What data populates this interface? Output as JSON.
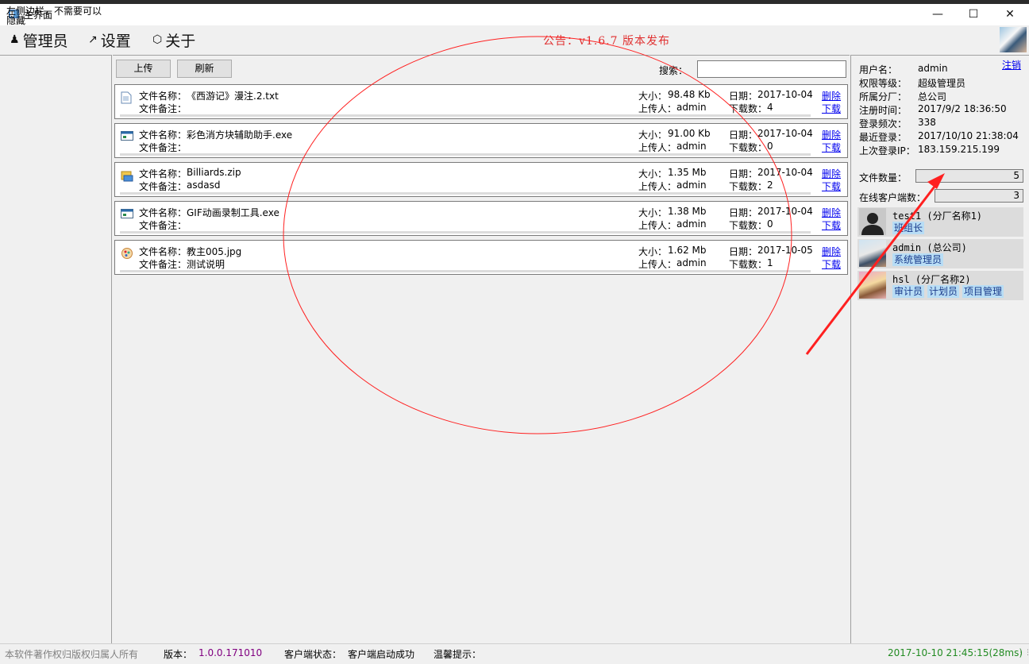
{
  "window": {
    "title": "主界面"
  },
  "menu": [
    {
      "label": "管理员",
      "icon": "users-icon"
    },
    {
      "label": "设置",
      "icon": "arrow-icon"
    },
    {
      "label": "关于",
      "icon": "cube-icon"
    }
  ],
  "notice": "公告：v1.6.7 版本发布",
  "sidebar": {
    "text": "左侧边栏，不需要可以隐藏"
  },
  "toolbar": {
    "upload_label": "上传",
    "refresh_label": "刷新",
    "search_label": "搜索：",
    "search_value": ""
  },
  "files": [
    {
      "name_label": "文件名称：",
      "name": "《西游记》漫注.2.txt",
      "note_label": "文件备注：",
      "note": "",
      "size_label": "大小：",
      "size": "98.48 Kb",
      "uploader_label": "上传人：",
      "uploader": "admin",
      "date_label": "日期：",
      "date": "2017-10-04",
      "downloads_label": "下载数：",
      "downloads": "4",
      "delete": "删除",
      "download": "下载",
      "icon": "text-file-icon"
    },
    {
      "name_label": "文件名称：",
      "name": "彩色消方块辅助助手.exe",
      "note_label": "文件备注：",
      "note": "",
      "size_label": "大小：",
      "size": "91.00 Kb",
      "uploader_label": "上传人：",
      "uploader": "admin",
      "date_label": "日期：",
      "date": "2017-10-04",
      "downloads_label": "下载数：",
      "downloads": "0",
      "delete": "删除",
      "download": "下载",
      "icon": "exe-file-icon"
    },
    {
      "name_label": "文件名称：",
      "name": "Billiards.zip",
      "note_label": "文件备注：",
      "note": "asdasd",
      "size_label": "大小：",
      "size": "1.35 Mb",
      "uploader_label": "上传人：",
      "uploader": "admin",
      "date_label": "日期：",
      "date": "2017-10-04",
      "downloads_label": "下载数：",
      "downloads": "2",
      "delete": "删除",
      "download": "下载",
      "icon": "zip-file-icon"
    },
    {
      "name_label": "文件名称：",
      "name": "GIF动画录制工具.exe",
      "note_label": "文件备注：",
      "note": "",
      "size_label": "大小：",
      "size": "1.38 Mb",
      "uploader_label": "上传人：",
      "uploader": "admin",
      "date_label": "日期：",
      "date": "2017-10-04",
      "downloads_label": "下载数：",
      "downloads": "0",
      "delete": "删除",
      "download": "下载",
      "icon": "exe-file-icon"
    },
    {
      "name_label": "文件名称：",
      "name": "教主005.jpg",
      "note_label": "文件备注：",
      "note": "测试说明",
      "size_label": "大小：",
      "size": "1.62 Mb",
      "uploader_label": "上传人：",
      "uploader": "admin",
      "date_label": "日期：",
      "date": "2017-10-05",
      "downloads_label": "下载数：",
      "downloads": "1",
      "delete": "删除",
      "download": "下载",
      "icon": "image-file-icon"
    }
  ],
  "account": {
    "logout": "注销",
    "rows": [
      {
        "label": "用户名：",
        "value": "admin"
      },
      {
        "label": "权限等级：",
        "value": "超级管理员"
      },
      {
        "label": "所属分厂：",
        "value": "总公司"
      },
      {
        "label": "注册时间：",
        "value": "2017/9/2 18:36:50"
      },
      {
        "label": "登录频次：",
        "value": "338"
      },
      {
        "label": "最近登录：",
        "value": "2017/10/10 21:38:04"
      },
      {
        "label": "上次登录IP：",
        "value": "183.159.215.199"
      }
    ]
  },
  "stats": {
    "file_count_label": "文件数量：",
    "file_count": "5",
    "online_label": "在线客户端数：",
    "online": "3"
  },
  "online_users": [
    {
      "name": "test1 (分厂名称1)",
      "tags": [
        "班组长"
      ],
      "avatar": "default-avatar"
    },
    {
      "name": "admin (总公司)",
      "tags": [
        "系统管理员"
      ],
      "avatar": "photo-avatar"
    },
    {
      "name": "hsl (分厂名称2)",
      "tags": [
        "审计员",
        "计划员",
        "项目管理"
      ],
      "avatar": "photo-avatar"
    }
  ],
  "status": {
    "copyright": "本软件著作权归版权归属人所有",
    "version_label": "版本：",
    "version": "1.0.0.171010",
    "client_state_label": "客户端状态：",
    "client_state": "客户端启动成功",
    "tip_label": "温馨提示：",
    "time": "2017-10-10 21:45:15(28ms)"
  },
  "colors": {
    "notice": "#e03030",
    "link": "#0000ee",
    "version": "#800080",
    "time": "#228b22",
    "annotation": "#ff2020",
    "tag_bg": "#b8ddf5"
  }
}
